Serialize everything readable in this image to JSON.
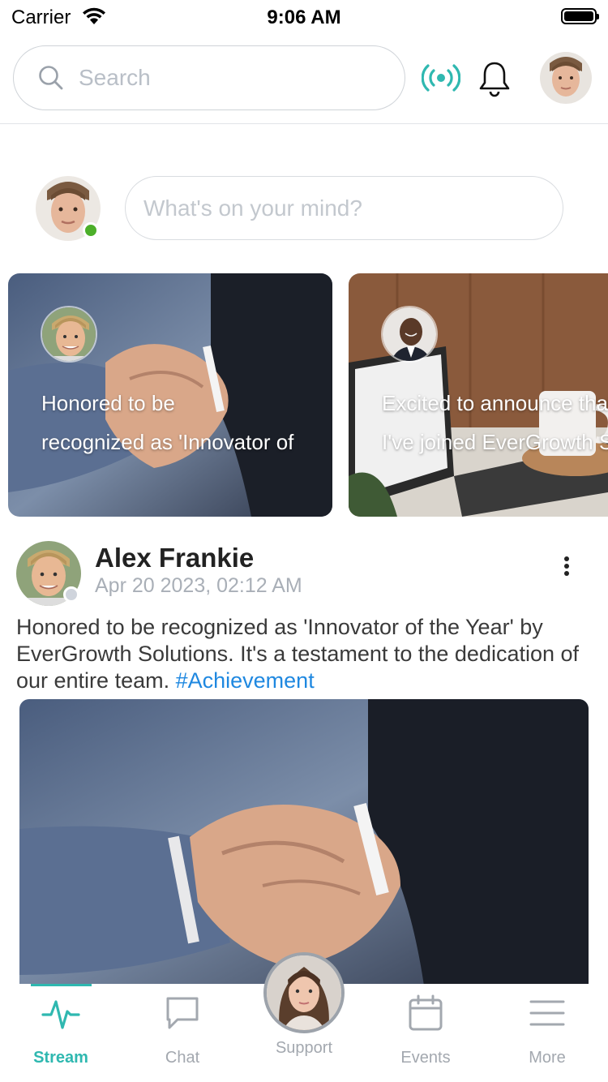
{
  "status_bar": {
    "carrier": "Carrier",
    "time": "9:06 AM"
  },
  "header": {
    "search_placeholder": "Search",
    "icons": {
      "search": "search-icon",
      "live": "broadcast-icon",
      "notifications": "bell-icon"
    }
  },
  "composer": {
    "placeholder": "What's on your mind?",
    "status": "online"
  },
  "stories": [
    {
      "text_line1": "Honored to be",
      "text_line2": "recognized as 'Innovator of the Year'"
    },
    {
      "text_line1": "Excited to announce that",
      "text_line2": "I've joined EverGrowth Solutions"
    }
  ],
  "post": {
    "author": "Alex Frankie",
    "date": "Apr 20 2023, 02:12 AM",
    "body": "Honored to be recognized as 'Innovator of the Year' by EverGrowth Solutions. It's a testament to the dedication of our entire team. ",
    "hashtag": "#Achievement"
  },
  "tabs": [
    {
      "label": "Stream",
      "icon": "activity-icon",
      "active": true
    },
    {
      "label": "Chat",
      "icon": "chat-icon"
    },
    {
      "label": "Support",
      "icon": "support-avatar"
    },
    {
      "label": "Events",
      "icon": "calendar-icon"
    },
    {
      "label": "More",
      "icon": "menu-icon"
    }
  ],
  "colors": {
    "accent": "#2fb8b0",
    "link": "#1f88e0",
    "online": "#4caf29"
  }
}
